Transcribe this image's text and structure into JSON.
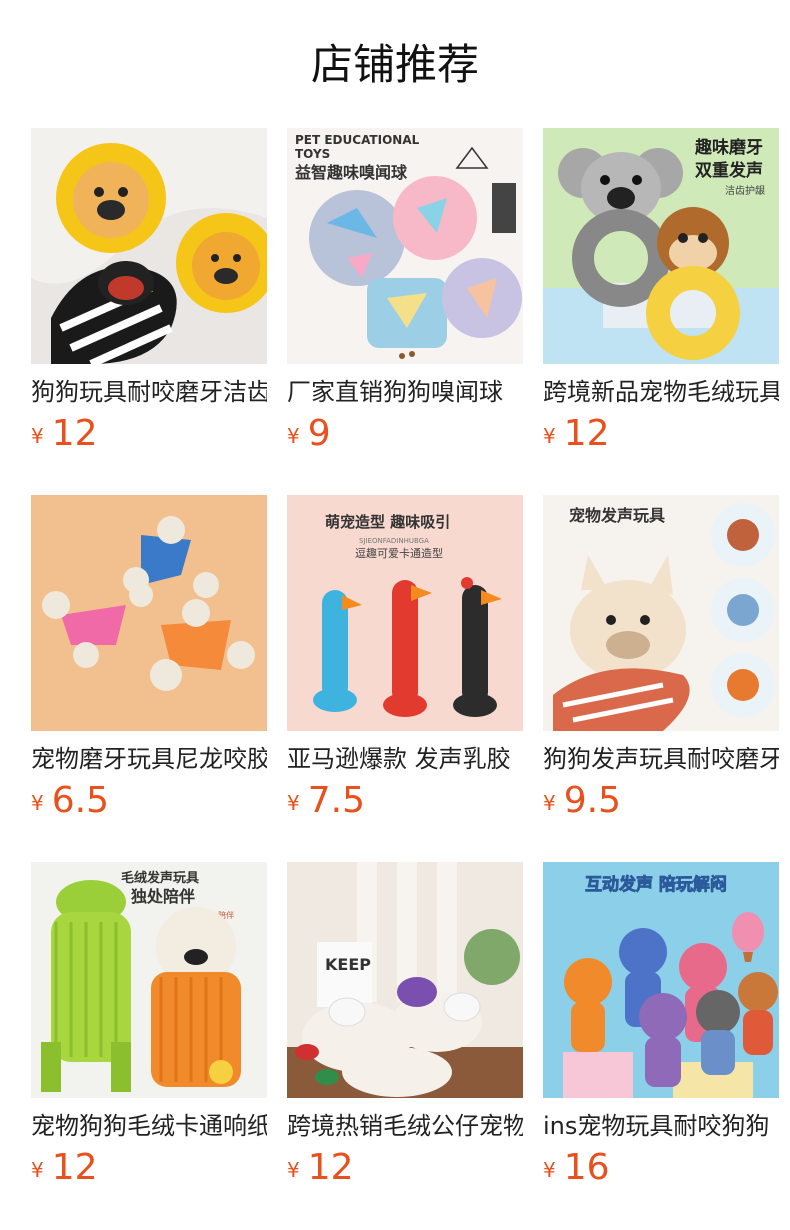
{
  "header": {
    "title": "店铺推荐"
  },
  "products": [
    {
      "name": "狗狗玩具耐咬磨牙洁齿",
      "currency": "¥",
      "price": "12",
      "icon": "lion-zebra-plush-toys-image"
    },
    {
      "name": "厂家直销狗狗嗅闻球",
      "currency": "¥",
      "price": "9",
      "icon": "snuffle-ball-toys-image",
      "image_text": {
        "line1": "PET EDUCATIONAL",
        "line2": "TOYS",
        "line3": "益智趣味嗅闻球"
      }
    },
    {
      "name": "跨境新品宠物毛绒玩具",
      "currency": "¥",
      "price": "12",
      "icon": "koala-monkey-ring-toys-image",
      "image_text": {
        "line1": "趣味磨牙",
        "line2": "双重发声",
        "line3": "洁齿护龈"
      }
    },
    {
      "name": "宠物磨牙玩具尼龙咬胶",
      "currency": "¥",
      "price": "6.5",
      "icon": "nylon-chew-bone-toys-image"
    },
    {
      "name": "亚马逊爆款 发声乳胶",
      "currency": "¥",
      "price": "7.5",
      "icon": "latex-chicken-toys-image",
      "image_text": {
        "line1": "萌宠造型 趣味吸引",
        "line2": "SJIEONFADINHUBGA",
        "line3": "逗趣可爱卡通造型"
      }
    },
    {
      "name": "狗狗发声玩具耐咬磨牙",
      "currency": "¥",
      "price": "9.5",
      "icon": "bulldog-plush-toys-image",
      "image_text": {
        "line1": "宠物发声玩具"
      }
    },
    {
      "name": "宠物狗狗毛绒卡通响纸",
      "currency": "¥",
      "price": "12",
      "icon": "frog-bear-plush-toys-image",
      "image_text": {
        "line1": "毛绒发声玩具",
        "line2": "独处陪伴",
        "line3": "发声 洁齿 陪伴"
      }
    },
    {
      "name": "跨境热销毛绒公仔宠物",
      "currency": "¥",
      "price": "12",
      "icon": "lamb-plush-toys-image",
      "image_text": {
        "line1": "KEEP"
      }
    },
    {
      "name": "ins宠物玩具耐咬狗狗",
      "currency": "¥",
      "price": "16",
      "icon": "animal-plush-toys-image",
      "image_text": {
        "line1": "互动发声 陪玩解闷"
      }
    }
  ]
}
